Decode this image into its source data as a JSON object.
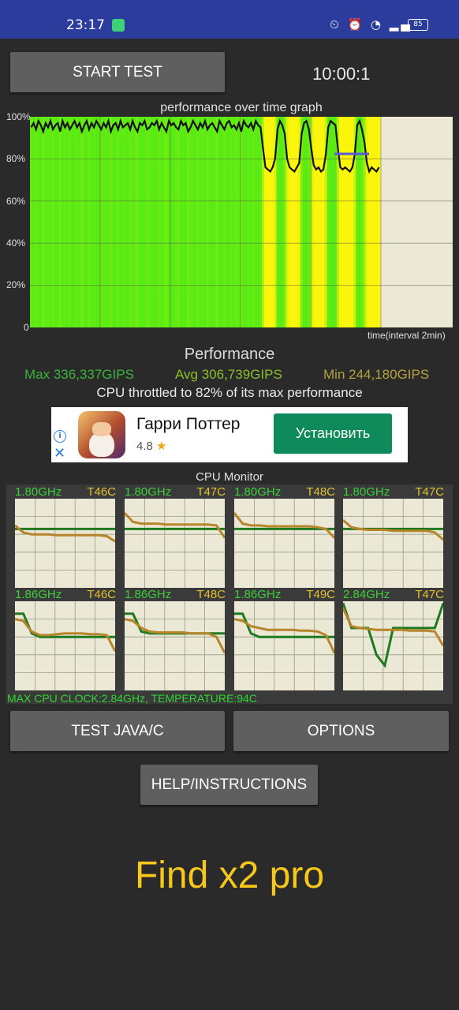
{
  "status_bar": {
    "time": "23:17",
    "battery": "85"
  },
  "header": {
    "start_button": "START TEST",
    "timer": "10:00:1"
  },
  "graph": {
    "title": "performance over time graph",
    "y_ticks": [
      "100%",
      "80%",
      "60%",
      "40%",
      "20%",
      "0"
    ],
    "x_label": "time(interval 2min)"
  },
  "chart_data": {
    "type": "area",
    "title": "performance over time graph",
    "xlabel": "time(interval 2min)",
    "ylabel": "",
    "ylim": [
      0,
      100
    ],
    "x_interval_minutes": 2,
    "values": [
      95,
      97,
      94,
      98,
      96,
      93,
      97,
      95,
      98,
      94,
      96,
      97,
      93,
      98,
      95,
      97,
      94,
      96,
      98,
      95,
      97,
      93,
      96,
      98,
      94,
      97,
      95,
      98,
      96,
      94,
      97,
      95,
      98,
      93,
      96,
      97,
      94,
      98,
      95,
      96,
      97,
      94,
      98,
      95,
      93,
      97,
      96,
      98,
      94,
      95,
      97,
      96,
      98,
      94,
      97,
      95,
      93,
      98,
      96,
      97,
      95,
      94,
      98,
      96,
      97,
      93,
      95,
      98,
      96,
      94,
      97,
      95,
      98,
      94,
      96,
      97,
      95,
      93,
      98,
      96,
      94,
      97,
      98,
      95,
      96,
      94,
      97,
      93,
      98,
      96,
      95,
      97,
      94,
      98,
      96,
      95,
      85,
      76,
      75,
      74,
      76,
      80,
      94,
      98,
      96,
      92,
      80,
      76,
      75,
      74,
      76,
      78,
      92,
      97,
      98,
      94,
      85,
      77,
      75,
      76,
      74,
      75,
      82,
      95,
      98,
      97,
      96,
      85,
      76,
      75,
      76,
      75,
      74,
      76,
      82,
      96,
      98,
      94,
      88,
      78,
      74,
      76,
      75,
      74,
      76
    ],
    "grid": true
  },
  "performance": {
    "title": "Performance",
    "max": "Max 336,337GIPS",
    "avg": "Avg 306,739GIPS",
    "min": "Min 244,180GIPS",
    "throttle_text": "CPU throttled to 82% of its max performance",
    "colors": {
      "max": "#3cb43c",
      "avg": "#8cbf2a",
      "min": "#b5a23b"
    }
  },
  "ad": {
    "title": "Гарри Поттер",
    "rating": "4.8",
    "install_label": "Установить"
  },
  "cpu_monitor": {
    "title": "CPU Monitor",
    "cores": [
      {
        "freq": "1.80GHz",
        "temp": "T46C",
        "freq_trace": [
          34,
          34,
          34,
          34,
          34,
          34,
          34,
          34,
          34,
          34,
          34,
          34,
          34
        ],
        "temp_trace": [
          30,
          38,
          40,
          40,
          40,
          41,
          41,
          41,
          41,
          41,
          41,
          42,
          48
        ]
      },
      {
        "freq": "1.80GHz",
        "temp": "T47C",
        "freq_trace": [
          34,
          34,
          34,
          34,
          34,
          34,
          34,
          34,
          34,
          34,
          34,
          34,
          34
        ],
        "temp_trace": [
          16,
          26,
          28,
          28,
          28,
          29,
          29,
          29,
          29,
          29,
          29,
          30,
          44
        ]
      },
      {
        "freq": "1.80GHz",
        "temp": "T48C",
        "freq_trace": [
          34,
          34,
          34,
          34,
          34,
          34,
          34,
          34,
          34,
          34,
          34,
          34,
          34
        ],
        "temp_trace": [
          16,
          28,
          30,
          30,
          31,
          31,
          31,
          31,
          31,
          31,
          32,
          34,
          44
        ]
      },
      {
        "freq": "1.80GHz",
        "temp": "T47C",
        "freq_trace": [
          34,
          34,
          34,
          34,
          34,
          34,
          34,
          34,
          34,
          34,
          34,
          34,
          34
        ],
        "temp_trace": [
          24,
          32,
          34,
          35,
          35,
          35,
          36,
          36,
          36,
          36,
          36,
          38,
          46
        ]
      },
      {
        "freq": "1.86GHz",
        "temp": "T46C",
        "freq_trace": [
          14,
          14,
          36,
          40,
          40,
          40,
          40,
          40,
          40,
          40,
          40,
          40,
          40
        ],
        "temp_trace": [
          20,
          22,
          34,
          38,
          38,
          37,
          36,
          36,
          36,
          37,
          37,
          38,
          56
        ]
      },
      {
        "freq": "1.86GHz",
        "temp": "T48C",
        "freq_trace": [
          14,
          14,
          34,
          36,
          36,
          36,
          36,
          36,
          36,
          36,
          36,
          36,
          36
        ],
        "temp_trace": [
          20,
          22,
          30,
          34,
          35,
          35,
          35,
          35,
          36,
          36,
          36,
          40,
          58
        ]
      },
      {
        "freq": "1.86GHz",
        "temp": "T49C",
        "freq_trace": [
          14,
          14,
          36,
          40,
          40,
          40,
          40,
          40,
          40,
          40,
          40,
          40,
          40
        ],
        "temp_trace": [
          20,
          22,
          28,
          30,
          32,
          32,
          32,
          32,
          33,
          33,
          34,
          38,
          58
        ]
      },
      {
        "freq": "2.84GHz",
        "temp": "T47C",
        "freq_trace": [
          2,
          30,
          30,
          30,
          60,
          72,
          30,
          30,
          30,
          30,
          30,
          30,
          2
        ],
        "temp_trace": [
          8,
          28,
          30,
          31,
          32,
          32,
          32,
          32,
          33,
          33,
          33,
          34,
          50
        ]
      }
    ],
    "max_clock_text": "MAX CPU CLOCK:2.84GHz, TEMPERATURE:94C"
  },
  "buttons": {
    "test_java": "TEST JAVA/C",
    "options": "OPTIONS",
    "help": "HELP/INSTRUCTIONS"
  },
  "device_name": "Find x2 pro"
}
